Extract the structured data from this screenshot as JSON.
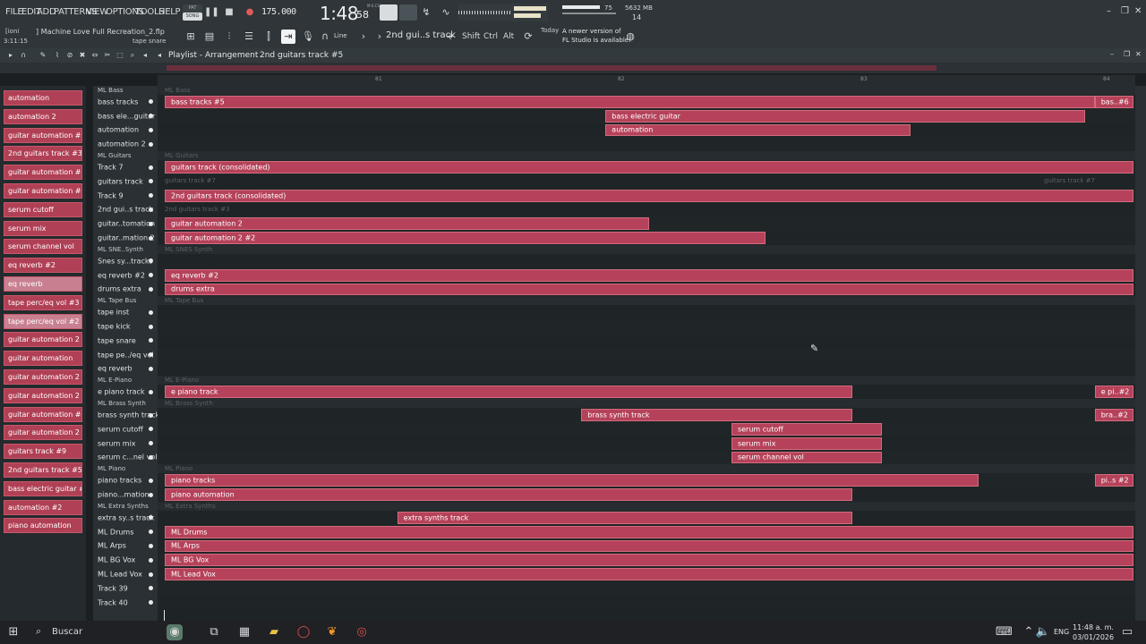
{
  "menu": [
    "FILE",
    "EDIT",
    "ADD",
    "PATTERNS",
    "VIEW",
    "OPTIONS",
    "TOOLS",
    "HELP"
  ],
  "mode": {
    "pat": "PAT",
    "song": "SONG"
  },
  "tempo": "175.000",
  "time": {
    "main": "1:48",
    "sub": "58",
    "label": "M:S:CS"
  },
  "monitor": {
    "cpu": "75",
    "memory": "5632 MB",
    "polyphony": "14"
  },
  "user": "[ioni",
  "project_title": "] Machine Love Full Recreation_2.flp",
  "song_position": "3:11:15",
  "hint": "tape snare",
  "snap": "Line",
  "selected_pattern": "2nd gui..s track",
  "mod_keys": [
    "Shift",
    "Ctrl",
    "Alt"
  ],
  "news": {
    "date": "Today",
    "line1": "A newer version of",
    "line2": "FL Studio is available!"
  },
  "playlist": {
    "title": "Playlist - Arrangement",
    "crumb": "2nd guitars track #5"
  },
  "ruler_bars": [
    "81",
    "82",
    "83",
    "84"
  ],
  "picker": [
    {
      "label": "automation",
      "dim": false
    },
    {
      "label": "automation 2",
      "dim": false
    },
    {
      "label": "guitar automation #2",
      "dim": false
    },
    {
      "label": "2nd guitars track #3",
      "dim": false
    },
    {
      "label": "guitar automation #5",
      "dim": false
    },
    {
      "label": "guitar automation #3",
      "dim": false
    },
    {
      "label": "serum cutoff",
      "dim": false
    },
    {
      "label": "serum mix",
      "dim": false
    },
    {
      "label": "serum channel vol",
      "dim": false
    },
    {
      "label": "eq reverb #2",
      "dim": false
    },
    {
      "label": "eq reverb",
      "dim": true
    },
    {
      "label": "tape perc/eq vol #3",
      "dim": false
    },
    {
      "label": "tape perc/eq vol #2",
      "dim": true
    },
    {
      "label": "guitar automation 2 #2",
      "dim": false
    },
    {
      "label": "guitar automation",
      "dim": false
    },
    {
      "label": "guitar automation 2",
      "dim": false
    },
    {
      "label": "guitar automation 2 #3",
      "dim": false
    },
    {
      "label": "guitar automation #6",
      "dim": false
    },
    {
      "label": "guitar automation 2 #4",
      "dim": false
    },
    {
      "label": "guitars track #9",
      "dim": false
    },
    {
      "label": "2nd guitars track #5",
      "dim": false
    },
    {
      "label": "bass electric guitar #3",
      "dim": false
    },
    {
      "label": "automation #2",
      "dim": false
    },
    {
      "label": "piano automation",
      "dim": false
    }
  ],
  "tracks": [
    {
      "name": "ML Bass",
      "type": "bus",
      "ghost": "ML Bass"
    },
    {
      "name": "bass tracks",
      "type": "track",
      "clips": [
        {
          "label": "bass tracks #5",
          "s": 0.0,
          "e": 0.96
        },
        {
          "label": "bas..#6",
          "s": 0.96,
          "e": 1.0
        }
      ]
    },
    {
      "name": "bass ele...guitar",
      "type": "track",
      "clips": [
        {
          "label": "bass electric guitar",
          "s": 0.455,
          "e": 0.95
        }
      ]
    },
    {
      "name": "automation",
      "type": "track",
      "clips": [
        {
          "label": "automation",
          "s": 0.455,
          "e": 0.77
        }
      ]
    },
    {
      "name": "automation 2",
      "type": "track",
      "clips": []
    },
    {
      "name": "ML Guitars",
      "type": "bus",
      "ghost": "ML Guitars"
    },
    {
      "name": "Track 7",
      "type": "folder",
      "clips": [
        {
          "label": "guitars track (consolidated)",
          "s": 0.0,
          "e": 1.0
        }
      ]
    },
    {
      "name": "guitars track",
      "type": "track",
      "ghost": "guitars track #7",
      "ghost2": "guitars track #7",
      "clips": []
    },
    {
      "name": "Track 9",
      "type": "folder",
      "clips": [
        {
          "label": "2nd guitars track (consolidated)",
          "s": 0.0,
          "e": 1.0
        }
      ]
    },
    {
      "name": "2nd gui..s track",
      "type": "track",
      "ghost": "2nd guitars track #3",
      "clips": []
    },
    {
      "name": "guitar..tomation",
      "type": "track",
      "clips": [
        {
          "label": "guitar automation 2",
          "s": 0.0,
          "e": 0.5
        }
      ]
    },
    {
      "name": "guitar..mation 2",
      "type": "track",
      "clips": [
        {
          "label": "guitar automation 2 #2",
          "s": 0.0,
          "e": 0.62
        }
      ]
    },
    {
      "name": "ML SNE..Synth",
      "type": "bus",
      "ghost": "ML SNES Synth"
    },
    {
      "name": "Snes sy...tracks",
      "type": "track",
      "clips": []
    },
    {
      "name": "eq reverb #2",
      "type": "track",
      "clips": [
        {
          "label": "eq reverb #2",
          "s": 0.0,
          "e": 1.0
        }
      ]
    },
    {
      "name": "drums extra",
      "type": "track",
      "clips": [
        {
          "label": "drums extra",
          "s": 0.0,
          "e": 1.0
        }
      ]
    },
    {
      "name": "ML Tape Bus",
      "type": "bus",
      "ghost": "ML Tape Bus"
    },
    {
      "name": "tape inst",
      "type": "track",
      "clips": []
    },
    {
      "name": "tape kick",
      "type": "track",
      "clips": []
    },
    {
      "name": "tape snare",
      "type": "track",
      "clips": []
    },
    {
      "name": "tape pe../eq vol",
      "type": "track",
      "clips": []
    },
    {
      "name": "eq reverb",
      "type": "track",
      "clips": []
    },
    {
      "name": "ML E-Piano",
      "type": "bus",
      "ghost": "ML E-Piano"
    },
    {
      "name": "e piano track",
      "type": "track",
      "clips": [
        {
          "label": "e piano track",
          "s": 0.0,
          "e": 0.71
        },
        {
          "label": "e pi..#2",
          "s": 0.96,
          "e": 1.0
        }
      ]
    },
    {
      "name": "ML Brass Synth",
      "type": "bus",
      "ghost": "ML Brass Synth"
    },
    {
      "name": "brass synth track",
      "type": "track",
      "clips": [
        {
          "label": "brass synth track",
          "s": 0.43,
          "e": 0.71
        },
        {
          "label": "bra..#2",
          "s": 0.96,
          "e": 1.0
        }
      ]
    },
    {
      "name": "serum cutoff",
      "type": "track",
      "clips": [
        {
          "label": "serum cutoff",
          "s": 0.585,
          "e": 0.74
        }
      ]
    },
    {
      "name": "serum mix",
      "type": "track",
      "clips": [
        {
          "label": "serum mix",
          "s": 0.585,
          "e": 0.74
        }
      ]
    },
    {
      "name": "serum c...nel vol",
      "type": "track",
      "clips": [
        {
          "label": "serum channel vol",
          "s": 0.585,
          "e": 0.74
        }
      ]
    },
    {
      "name": "ML Piano",
      "type": "bus",
      "ghost": "ML Piano"
    },
    {
      "name": "piano tracks",
      "type": "track",
      "clips": [
        {
          "label": "piano tracks",
          "s": 0.0,
          "e": 0.84
        },
        {
          "label": "pi..s #2",
          "s": 0.96,
          "e": 1.0
        }
      ]
    },
    {
      "name": "piano...mation",
      "type": "track",
      "clips": [
        {
          "label": "piano automation",
          "s": 0.0,
          "e": 0.71
        }
      ]
    },
    {
      "name": "ML Extra Synths",
      "type": "bus",
      "ghost": "ML Extra Synths"
    },
    {
      "name": "extra sy..s track",
      "type": "track",
      "clips": [
        {
          "label": "extra synths track",
          "s": 0.24,
          "e": 0.71
        }
      ]
    },
    {
      "name": "ML Drums",
      "type": "folder",
      "clips": [
        {
          "label": "ML Drums",
          "s": 0.0,
          "e": 1.0
        }
      ]
    },
    {
      "name": "ML Arps",
      "type": "folder",
      "clips": [
        {
          "label": "ML Arps",
          "s": 0.0,
          "e": 1.0
        }
      ]
    },
    {
      "name": "ML BG Vox",
      "type": "folder",
      "clips": [
        {
          "label": "ML BG Vox",
          "s": 0.0,
          "e": 1.0
        }
      ]
    },
    {
      "name": "ML Lead Vox",
      "type": "folder",
      "clips": [
        {
          "label": "ML Lead Vox",
          "s": 0.0,
          "e": 1.0
        }
      ]
    },
    {
      "name": "Track 39",
      "type": "empty",
      "clips": []
    },
    {
      "name": "Track 40",
      "type": "empty",
      "clips": []
    }
  ],
  "taskbar": {
    "search": "Buscar",
    "lang": "ENG",
    "time": "11:48 a. m.",
    "date": "03/01/2026"
  },
  "colors": {
    "clip": "#b5425a",
    "clip_border": "#d26c7f",
    "picker": "#b04055",
    "background": "#1e2325"
  }
}
